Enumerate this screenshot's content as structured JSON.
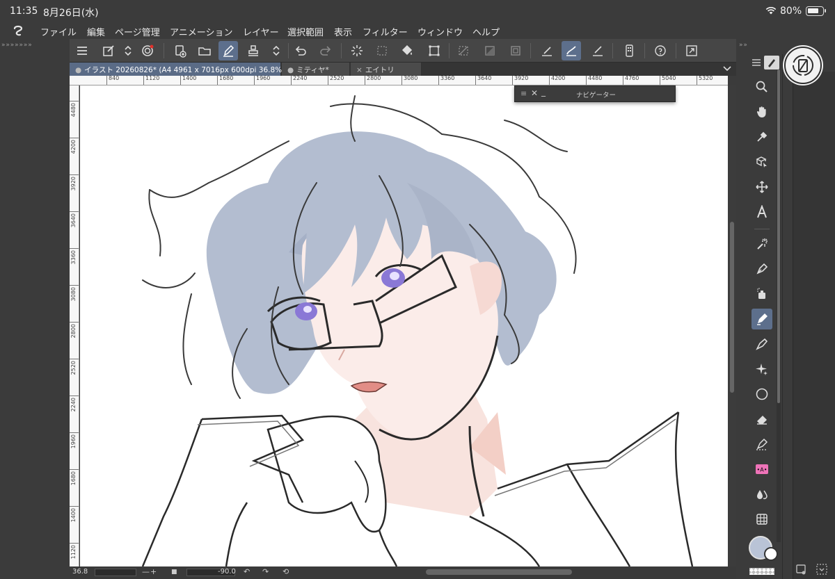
{
  "status": {
    "time": "11:35",
    "date": "8月26日(水)",
    "battery": "80%"
  },
  "menu": {
    "items": [
      "ファイル",
      "編集",
      "ページ管理",
      "アニメーション",
      "レイヤー",
      "選択範囲",
      "表示",
      "フィルター",
      "ウィンドウ",
      "ヘルプ"
    ]
  },
  "collapse": {
    "left": "» » » » » » »",
    "right": "» »"
  },
  "tabs": {
    "items": [
      {
        "label": "イラスト 20260826* (A4 4961 x 7016px 600dpi 36.8%)",
        "prefix": "●",
        "active": true
      },
      {
        "label": "ミティヤ*",
        "prefix": "●",
        "active": false
      },
      {
        "label": "エイトリ",
        "prefix": "×",
        "active": false
      }
    ]
  },
  "ruler": {
    "top": [
      "840",
      "1120",
      "1400",
      "1680",
      "1960",
      "2240",
      "2520",
      "2800",
      "3080",
      "3360",
      "3640",
      "3920",
      "4200",
      "4480",
      "4760",
      "5040",
      "5320"
    ],
    "left": [
      "4480",
      "4200",
      "3920",
      "3640",
      "3360",
      "3080",
      "2800",
      "2520",
      "2240",
      "1960",
      "1680",
      "1400",
      "1120"
    ]
  },
  "navigator": {
    "title": "ナビゲーター",
    "handle": "≡",
    "close": "✕",
    "minimize": "_"
  },
  "bottom": {
    "zoom": "36.8",
    "minus": "—",
    "plus": "+",
    "angle": "-90.0",
    "stop": "■",
    "rotate_left": "↶",
    "rotate_right": "↷",
    "reset": "⟲"
  },
  "colors": {
    "accent": "#5d6f8c",
    "main_color": "#b9c3d6",
    "sub_color": "#ffffff",
    "hair": "#b3bdd0",
    "skin": "#f6d9d3",
    "iris": "#8a78d6"
  }
}
